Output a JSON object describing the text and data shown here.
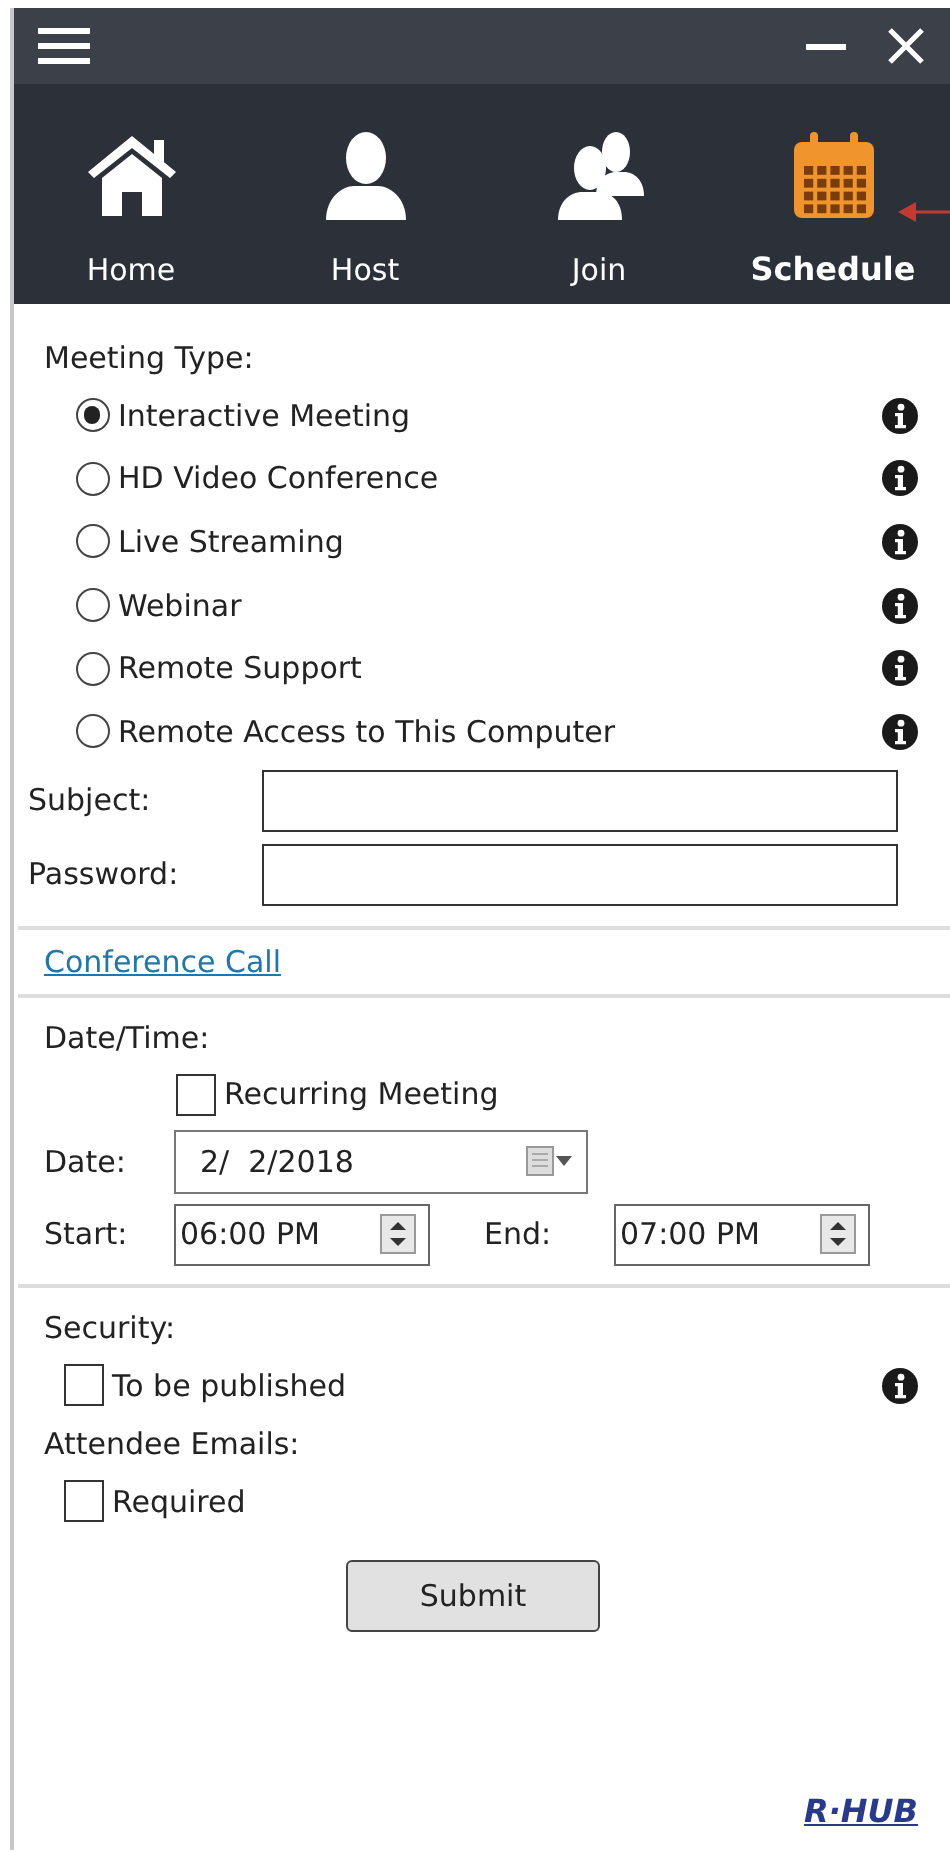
{
  "nav_tabs": [
    {
      "kind": "home",
      "label": "Home",
      "selected": false
    },
    {
      "kind": "host",
      "label": "Host",
      "selected": false
    },
    {
      "kind": "join",
      "label": "Join",
      "selected": false
    },
    {
      "kind": "schedule",
      "label": "Schedule",
      "selected": true
    }
  ],
  "meeting_type": {
    "label": "Meeting Type:",
    "options": [
      {
        "label": "Interactive Meeting",
        "selected": true
      },
      {
        "label": "HD Video Conference",
        "selected": false
      },
      {
        "label": "Live Streaming",
        "selected": false
      },
      {
        "label": "Webinar",
        "selected": false
      },
      {
        "label": "Remote Support",
        "selected": false
      },
      {
        "label": "Remote Access to This Computer",
        "selected": false
      }
    ]
  },
  "fields": [
    {
      "label": "Subject:"
    },
    {
      "label": "Password:"
    }
  ],
  "conference_call_link": "Conference Call",
  "date_time": {
    "label": "Date/Time:",
    "recurring": {
      "label": "Recurring Meeting",
      "checked": false
    },
    "date": {
      "label": "Date:",
      "value": "2/  2/2018"
    },
    "start": {
      "label": "Start:",
      "value": "06:00 PM"
    },
    "end": {
      "label": "End:",
      "value": "07:00 PM"
    }
  },
  "security": {
    "label": "Security:",
    "option": {
      "label": "To be published",
      "checked": false
    }
  },
  "attendee_emails": {
    "label": "Attendee Emails:",
    "option": {
      "label": "Required",
      "checked": false
    }
  },
  "submit_button": "Submit",
  "logo": "R·HUB"
}
